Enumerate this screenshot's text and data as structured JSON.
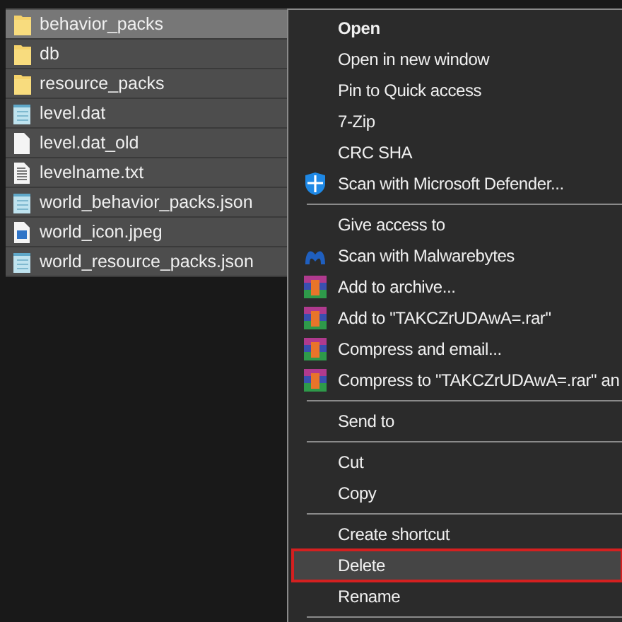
{
  "files": [
    {
      "name": "behavior_packs",
      "kind": "folder",
      "selected": true,
      "hovered": true
    },
    {
      "name": "db",
      "kind": "folder",
      "selected": true,
      "hovered": false
    },
    {
      "name": "resource_packs",
      "kind": "folder",
      "selected": true,
      "hovered": false
    },
    {
      "name": "level.dat",
      "kind": "notepad",
      "selected": true,
      "hovered": false
    },
    {
      "name": "level.dat_old",
      "kind": "blank",
      "selected": true,
      "hovered": false
    },
    {
      "name": "levelname.txt",
      "kind": "text",
      "selected": true,
      "hovered": false
    },
    {
      "name": "world_behavior_packs.json",
      "kind": "notepad",
      "selected": true,
      "hovered": false
    },
    {
      "name": "world_icon.jpeg",
      "kind": "image",
      "selected": true,
      "hovered": false
    },
    {
      "name": "world_resource_packs.json",
      "kind": "notepad",
      "selected": true,
      "hovered": false
    }
  ],
  "context_menu": [
    {
      "kind": "item",
      "label": "Open",
      "default": true,
      "selected": false,
      "outlined": false
    },
    {
      "kind": "item",
      "label": "Open in new window",
      "default": false,
      "selected": false,
      "outlined": false
    },
    {
      "kind": "item",
      "label": "Pin to Quick access",
      "default": false,
      "selected": false,
      "outlined": false
    },
    {
      "kind": "item",
      "label": "7-Zip",
      "default": false,
      "selected": false,
      "outlined": false
    },
    {
      "kind": "item",
      "label": "CRC SHA",
      "default": false,
      "selected": false,
      "outlined": false
    },
    {
      "kind": "shield",
      "label": "Scan with Microsoft Defender...",
      "default": false,
      "selected": false,
      "outlined": false
    },
    {
      "kind": "separator"
    },
    {
      "kind": "item",
      "label": "Give access to",
      "default": false,
      "selected": false,
      "outlined": false
    },
    {
      "kind": "m-logo",
      "label": "Scan with Malwarebytes",
      "default": false,
      "selected": false,
      "outlined": false
    },
    {
      "kind": "archive",
      "label": "Add to archive...",
      "default": false,
      "selected": false,
      "outlined": false
    },
    {
      "kind": "archive",
      "label": "Add to \"TAKCZrUDAwA=.rar\"",
      "default": false,
      "selected": false,
      "outlined": false
    },
    {
      "kind": "archive",
      "label": "Compress and email...",
      "default": false,
      "selected": false,
      "outlined": false
    },
    {
      "kind": "archive",
      "label": "Compress to \"TAKCZrUDAwA=.rar\" an",
      "default": false,
      "selected": false,
      "outlined": false
    },
    {
      "kind": "separator"
    },
    {
      "kind": "item",
      "label": "Send to",
      "default": false,
      "selected": false,
      "outlined": false
    },
    {
      "kind": "separator"
    },
    {
      "kind": "item",
      "label": "Cut",
      "default": false,
      "selected": false,
      "outlined": false
    },
    {
      "kind": "item",
      "label": "Copy",
      "default": false,
      "selected": false,
      "outlined": false
    },
    {
      "kind": "separator"
    },
    {
      "kind": "item",
      "label": "Create shortcut",
      "default": false,
      "selected": false,
      "outlined": false
    },
    {
      "kind": "item",
      "label": "Delete",
      "default": false,
      "selected": true,
      "outlined": true
    },
    {
      "kind": "item",
      "label": "Rename",
      "default": false,
      "selected": false,
      "outlined": false
    },
    {
      "kind": "separator"
    }
  ]
}
